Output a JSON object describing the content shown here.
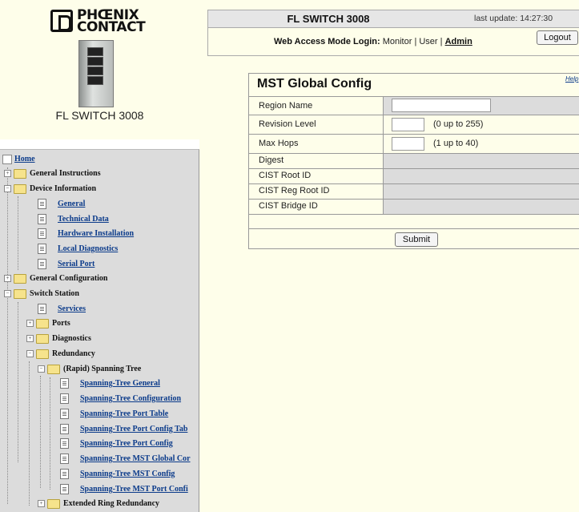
{
  "brand": {
    "line1": "PHŒNIX",
    "line2": "CONTACT"
  },
  "device": {
    "label": "FL SWITCH 3008",
    "image_icon": "switch-device-icon"
  },
  "nav": {
    "home": "Home",
    "items": [
      {
        "label": "General Instructions",
        "type": "folder",
        "toggle": "+"
      },
      {
        "label": "Device Information",
        "type": "folder",
        "toggle": "−"
      },
      {
        "label": "General",
        "type": "page"
      },
      {
        "label": "Technical Data",
        "type": "page"
      },
      {
        "label": "Hardware Installation",
        "type": "page"
      },
      {
        "label": "Local Diagnostics",
        "type": "page"
      },
      {
        "label": "Serial Port",
        "type": "page"
      },
      {
        "label": "General Configuration",
        "type": "folder",
        "toggle": "+"
      },
      {
        "label": "Switch Station",
        "type": "folder",
        "toggle": "−"
      },
      {
        "label": "Services",
        "type": "page"
      },
      {
        "label": "Ports",
        "type": "folder",
        "toggle": "+"
      },
      {
        "label": "Diagnostics",
        "type": "folder",
        "toggle": "+"
      },
      {
        "label": "Redundancy",
        "type": "folder",
        "toggle": "−"
      },
      {
        "label": "(Rapid) Spanning Tree",
        "type": "folder",
        "toggle": "−"
      },
      {
        "label": "Spanning-Tree General",
        "type": "page"
      },
      {
        "label": "Spanning-Tree Configuration",
        "type": "page"
      },
      {
        "label": "Spanning-Tree Port Table",
        "type": "page"
      },
      {
        "label": "Spanning-Tree Port Config Tab",
        "type": "page"
      },
      {
        "label": "Spanning-Tree Port Config",
        "type": "page"
      },
      {
        "label": "Spanning-Tree MST Global Cor",
        "type": "page"
      },
      {
        "label": "Spanning-Tree MST Config",
        "type": "page"
      },
      {
        "label": "Spanning-Tree MST Port Confi",
        "type": "page"
      },
      {
        "label": "Extended Ring Redundancy",
        "type": "folder",
        "toggle": "+"
      }
    ]
  },
  "header": {
    "title": "FL SWITCH 3008",
    "last_update": "last update: 14:27:30",
    "login_prefix": "Web Access Mode Login:",
    "login_modes": "Monitor | User |",
    "login_admin": "Admin",
    "logout_label": "Logout"
  },
  "panel": {
    "title": "MST Global Config",
    "help": "Help",
    "rows": [
      {
        "label": "Region Name",
        "input_value": "",
        "hint": ""
      },
      {
        "label": "Revision Level",
        "input_value": "",
        "hint": "(0 up to 255)"
      },
      {
        "label": "Max Hops",
        "input_value": "",
        "hint": "(1 up to 40)"
      },
      {
        "label": "Digest",
        "value": ""
      },
      {
        "label": "CIST Root ID",
        "value": ""
      },
      {
        "label": "CIST Reg Root ID",
        "value": ""
      },
      {
        "label": "CIST Bridge ID",
        "value": ""
      }
    ],
    "submit_label": "Submit"
  },
  "colors": {
    "page_bg": "#fefeea",
    "nav_bg": "#dcdcdc",
    "link": "#0a3a8a"
  }
}
